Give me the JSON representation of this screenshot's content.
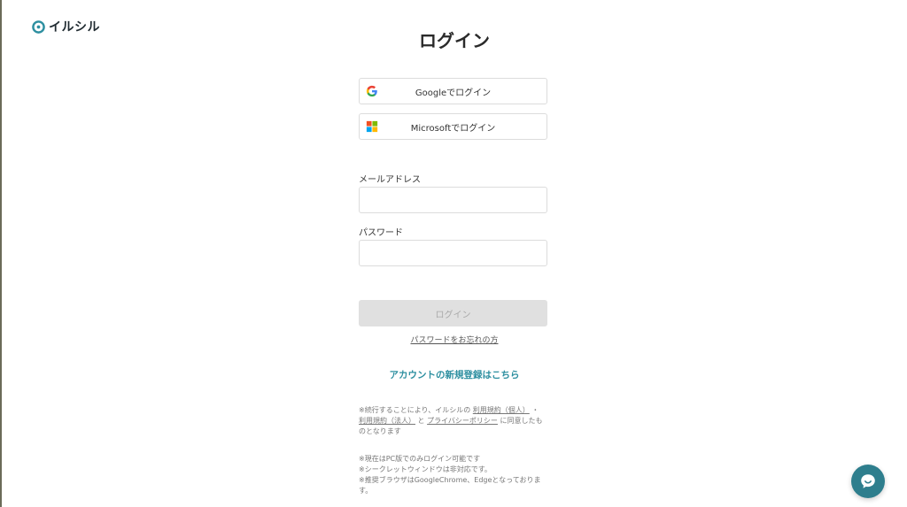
{
  "brand": {
    "name": "イルシル",
    "accent_color": "#2d8fa0"
  },
  "page": {
    "title": "ログイン"
  },
  "sso": {
    "google_label": "Googleでログイン",
    "microsoft_label": "Microsoftでログイン"
  },
  "form": {
    "email_label": "メールアドレス",
    "email_value": "",
    "password_label": "パスワード",
    "password_value": "",
    "submit_label": "ログイン"
  },
  "links": {
    "forgot_password": "パスワードをお忘れの方",
    "signup": "アカウントの新規登録はこちら"
  },
  "terms": {
    "prefix": "※続行することにより、イルシルの",
    "personal_terms": "利用規約（個人）",
    "separator": "・",
    "corporate_terms": "利用規約（法人）",
    "and": "と",
    "privacy_policy": "プライバシーポリシー",
    "suffix": "に同意したものとなります"
  },
  "notices": [
    "※現在はPC版でのみログイン可能です",
    "※シークレットウィンドウは非対応です。",
    "※推奨ブラウザはGoogleChrome、Edgeとなっております。"
  ],
  "icons": {
    "brand": "brand-logo-icon",
    "google": "google-icon",
    "microsoft": "microsoft-icon",
    "chat": "chat-icon"
  }
}
